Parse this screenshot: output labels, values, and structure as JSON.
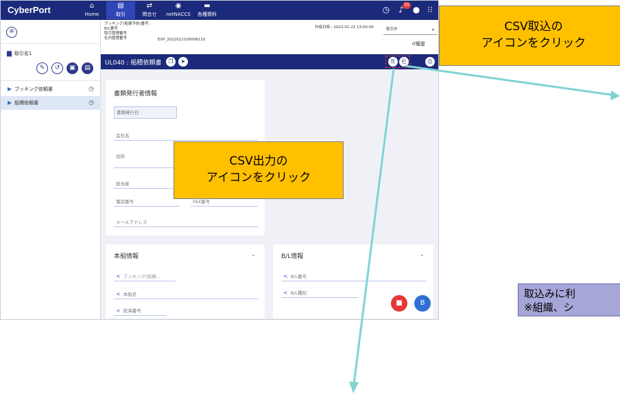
{
  "app": {
    "brand": "CyberPort",
    "nav": [
      {
        "label": "Home",
        "icon": "home-icon"
      },
      {
        "label": "取引",
        "icon": "deal-icon"
      },
      {
        "label": "問合せ",
        "icon": "inquiry-icon"
      },
      {
        "label": "netNACCS",
        "icon": "netnaccs-icon"
      },
      {
        "label": "各種資料",
        "icon": "folder-icon"
      }
    ],
    "notification_count": "30"
  },
  "sidebar": {
    "deal_name": "取引名1",
    "items": [
      {
        "label": "ブッキング依頼書"
      },
      {
        "label": "船積依頼書"
      }
    ]
  },
  "info": {
    "labels": [
      "ブッキング(船積予約)番号 :",
      "B/L番号",
      "取引管理番号",
      "社内管理番号"
    ],
    "deal_mgmt_value": "EXP_2022012100006110",
    "created_date": "作成日時 : 2022-01-21 13:00:06",
    "status": "取引中",
    "history_label": "履歴"
  },
  "title": "UL040 : 船積依頼書",
  "issuer_card": {
    "title": "書類発行者情報",
    "fields": {
      "issue_date": "書類発行日",
      "company": "会社名",
      "address": "住所",
      "person": "担当者",
      "phone": "電話番号",
      "fax": "FAX番号",
      "email": "メールアドレス"
    }
  },
  "vessel_card": {
    "title": "本船情報",
    "fields": [
      "ブッキング(船積...",
      "本船名",
      "航海番号"
    ]
  },
  "bl_card": {
    "title": "B/L情報",
    "fields": [
      "B/L番号",
      "B/L種別"
    ]
  },
  "callouts": {
    "csv_import": [
      "CSV取込の",
      "アイコンをクリック"
    ],
    "csv_export": [
      "CSV出力の",
      "アイコンをクリック"
    ],
    "note": [
      "取込みに利",
      "※組織、シ"
    ]
  },
  "colors": {
    "nav_bg": "#1b2a7a",
    "callout": "#ffc000",
    "arrow": "#7fd3d3"
  }
}
